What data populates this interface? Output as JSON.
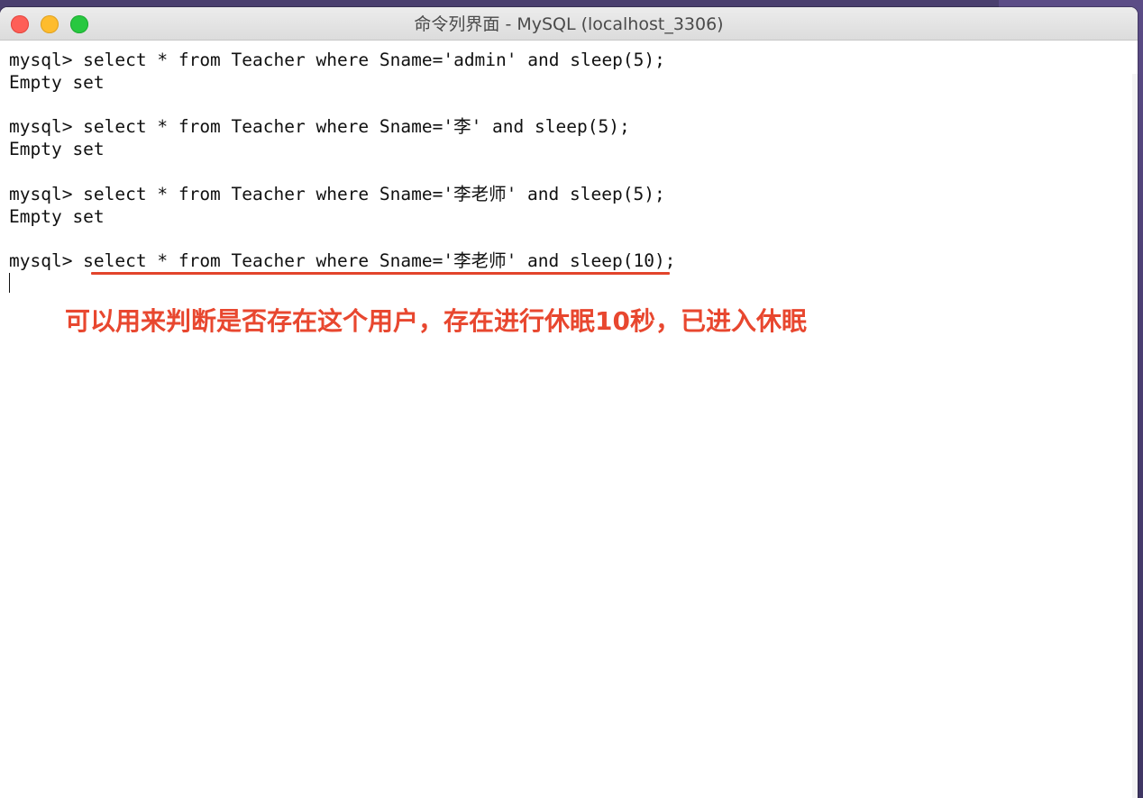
{
  "window": {
    "title": "命令列界面 - MySQL (localhost_3306)"
  },
  "terminal": {
    "lines": [
      "mysql> select * from Teacher where Sname='admin' and sleep(5);",
      "Empty set",
      "mysql> select * from Teacher where Sname='李' and sleep(5);",
      "Empty set",
      "mysql> select * from Teacher where Sname='李老师' and sleep(5);",
      "Empty set",
      "mysql> select * from Teacher where Sname='李老师' and sleep(10);"
    ]
  },
  "annotation": {
    "text": "可以用来判断是否存在这个用户，存在进行休眠10秒，已进入休眠",
    "color": "#e8472f"
  },
  "colors": {
    "close": "#fe5f57",
    "minimize": "#febc2e",
    "zoom": "#28c840"
  }
}
